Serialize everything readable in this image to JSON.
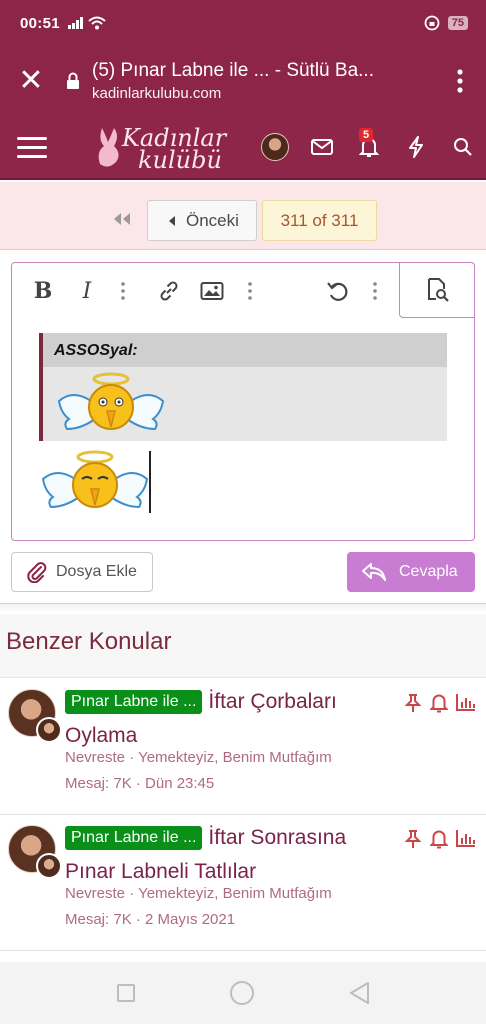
{
  "status_bar": {
    "time": "00:51",
    "battery": "75"
  },
  "browser": {
    "title": "(5) Pınar Labne ile ... - Sütlü Ba...",
    "domain": "kadinlarkulubu.com"
  },
  "site": {
    "logo_line1": "Kadınlar",
    "logo_line2": "kulübü",
    "notification_count": "5"
  },
  "pager": {
    "prev_label": "Önceki",
    "page_indicator": "311 of 311"
  },
  "editor": {
    "quote_author": "ASSOSyal:"
  },
  "actions": {
    "attach_label": "Dosya Ekle",
    "reply_label": "Cevapla"
  },
  "similar": {
    "heading": "Benzer Konular",
    "threads": [
      {
        "prefix": "Pınar Labne ile ...",
        "title": "İftar Çorbaları Oylama",
        "meta1": "Nevreste · Yemekteyiz, Benim Mutfağım",
        "meta2": "Mesaj: 7K · Dün 23:45"
      },
      {
        "prefix": "Pınar Labne ile ...",
        "title": "İftar Sonrasına Pınar Labneli Tatlılar",
        "meta1": "Nevreste · Yemekteyiz, Benim Mutfağım",
        "meta2": "Mesaj: 7K · 2 Mayıs 2021"
      }
    ]
  },
  "colors": {
    "brand": "#8c2547",
    "prefix_green": "#0a8f19",
    "reply_button": "#c87cd2"
  },
  "icons": [
    "close-icon",
    "lock-icon",
    "more-vert-icon",
    "hamburger-icon",
    "mail-icon",
    "bell-icon",
    "bolt-icon",
    "search-icon",
    "bold-icon",
    "italic-icon",
    "link-icon",
    "image-icon",
    "undo-icon",
    "preview-icon",
    "paperclip-icon",
    "reply-icon",
    "pin-icon",
    "chart-icon"
  ]
}
